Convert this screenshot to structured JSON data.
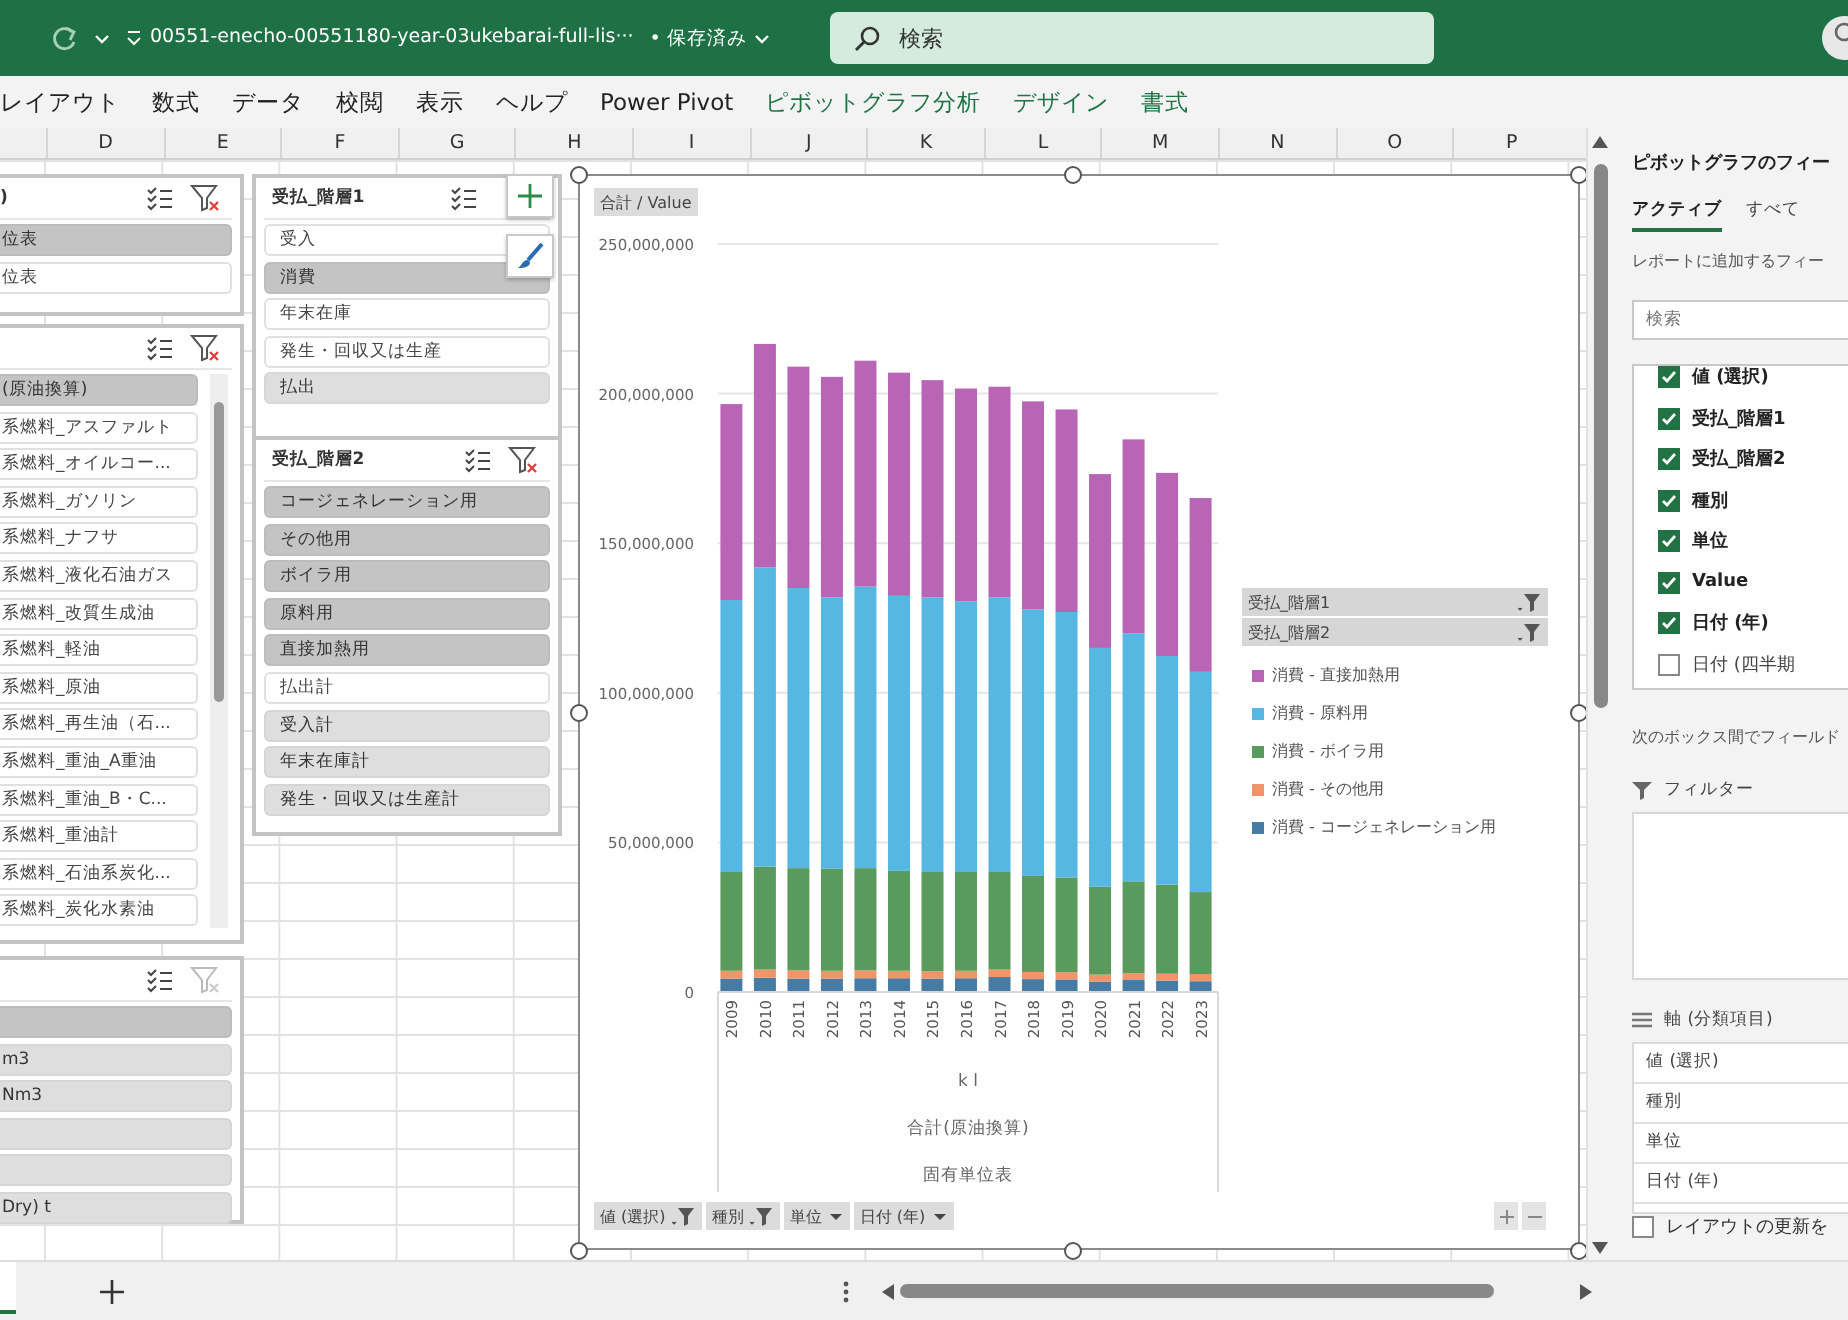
{
  "title_bar": {
    "title": "00551-enecho-00551180-year-03ukebarai-full-lis···",
    "save_status": "• 保存済み",
    "search": {
      "placeholder": "検索"
    }
  },
  "ribbon_tabs": [
    {
      "label": "レイアウト",
      "contextual": false
    },
    {
      "label": "数式",
      "contextual": false
    },
    {
      "label": "データ",
      "contextual": false
    },
    {
      "label": "校閲",
      "contextual": false
    },
    {
      "label": "表示",
      "contextual": false
    },
    {
      "label": "ヘルプ",
      "contextual": false
    },
    {
      "label": "Power Pivot",
      "contextual": false
    },
    {
      "label": "ピボットグラフ分析",
      "contextual": true
    },
    {
      "label": "デザイン",
      "contextual": true
    },
    {
      "label": "書式",
      "contextual": true
    }
  ],
  "columns": [
    "D",
    "E",
    "F",
    "G",
    "H",
    "I",
    "J",
    "K",
    "L",
    "M",
    "N",
    "O",
    "P"
  ],
  "slicers": [
    {
      "title": ")",
      "clear_filter_enabled": true,
      "items": [
        {
          "label": "位表",
          "selected": true,
          "has_data": true
        },
        {
          "label": "位表",
          "selected": false,
          "has_data": true
        }
      ]
    },
    {
      "clear_filter_enabled": true,
      "items": [
        {
          "label": "(原油換算)",
          "selected": true,
          "has_data": true
        },
        {
          "label": "系燃料_アスファルト",
          "selected": false,
          "has_data": true
        },
        {
          "label": "系燃料_オイルコー...",
          "selected": false,
          "has_data": true
        },
        {
          "label": "系燃料_ガソリン",
          "selected": false,
          "has_data": true
        },
        {
          "label": "系燃料_ナフサ",
          "selected": false,
          "has_data": true
        },
        {
          "label": "系燃料_液化石油ガス",
          "selected": false,
          "has_data": true
        },
        {
          "label": "系燃料_改質生成油",
          "selected": false,
          "has_data": true
        },
        {
          "label": "系燃料_軽油",
          "selected": false,
          "has_data": true
        },
        {
          "label": "系燃料_原油",
          "selected": false,
          "has_data": true
        },
        {
          "label": "系燃料_再生油（石...",
          "selected": false,
          "has_data": true
        },
        {
          "label": "系燃料_重油_A重油",
          "selected": false,
          "has_data": true
        },
        {
          "label": "系燃料_重油_B・C...",
          "selected": false,
          "has_data": true
        },
        {
          "label": "系燃料_重油計",
          "selected": false,
          "has_data": true
        },
        {
          "label": "系燃料_石油系炭化...",
          "selected": false,
          "has_data": true
        },
        {
          "label": "系燃料_炭化水素油",
          "selected": false,
          "has_data": true
        }
      ]
    },
    {
      "clear_filter_enabled": false,
      "items": [
        {
          "selected": true,
          "has_data": true
        },
        {
          "label": "m3",
          "selected": true,
          "has_data": false
        },
        {
          "label": "Nm3",
          "selected": true,
          "has_data": false
        },
        {
          "selected": true,
          "has_data": false
        },
        {
          "selected": true,
          "has_data": false
        },
        {
          "label": "Dry) t",
          "selected": true,
          "has_data": false
        }
      ]
    },
    {
      "title": "受払_階層1",
      "items": [
        {
          "label": "受入",
          "selected": false,
          "has_data": true
        },
        {
          "label": "消費",
          "selected": true,
          "has_data": true
        },
        {
          "label": "年末在庫",
          "selected": false,
          "has_data": true
        },
        {
          "label": "発生・回収又は生産",
          "selected": false,
          "has_data": true
        },
        {
          "label": "払出",
          "selected": true,
          "has_data": false
        }
      ]
    },
    {
      "title": "受払_階層2",
      "clear_filter_enabled": true,
      "items": [
        {
          "label": "コージェネレーション用",
          "selected": true,
          "has_data": true
        },
        {
          "label": "その他用",
          "selected": true,
          "has_data": true
        },
        {
          "label": "ボイラ用",
          "selected": true,
          "has_data": true
        },
        {
          "label": "原料用",
          "selected": true,
          "has_data": true
        },
        {
          "label": "直接加熱用",
          "selected": true,
          "has_data": true
        },
        {
          "label": "払出計",
          "selected": false,
          "has_data": true
        },
        {
          "label": "受入計",
          "selected": true,
          "has_data": false
        },
        {
          "label": "年末在庫計",
          "selected": true,
          "has_data": false
        },
        {
          "label": "発生・回収又は生産計",
          "selected": true,
          "has_data": false
        }
      ]
    }
  ],
  "chart": {
    "value_button": "合計 / Value",
    "legend_fields": [
      {
        "label": "受払_階層1",
        "filtered": true
      },
      {
        "label": "受払_階層2",
        "filtered": true
      }
    ],
    "axis_fields": [
      {
        "label": "値 (選択)",
        "filtered": true
      },
      {
        "label": "種別",
        "filtered": true
      },
      {
        "label": "単位",
        "filtered": false
      },
      {
        "label": "日付 (年)",
        "filtered": false
      }
    ],
    "category_levels": [
      "k l",
      "合計(原油換算)",
      "固有単位表"
    ],
    "chart_data": {
      "type": "bar",
      "stacked": true,
      "orientation": "vertical",
      "grid": true,
      "categories": [
        "2009",
        "2010",
        "2011",
        "2012",
        "2013",
        "2014",
        "2015",
        "2016",
        "2017",
        "2018",
        "2019",
        "2020",
        "2021",
        "2022",
        "2023"
      ],
      "ylim": [
        0,
        250000000
      ],
      "yticks": [
        {
          "value": 0,
          "label": "0"
        },
        {
          "value": 50000000,
          "label": "50,000,000"
        },
        {
          "value": 100000000,
          "label": "100,000,000"
        },
        {
          "value": 150000000,
          "label": "150,000,000"
        },
        {
          "value": 200000000,
          "label": "200,000,000"
        },
        {
          "value": 250000000,
          "label": "250,000,000"
        }
      ],
      "series": [
        {
          "name": "消費 - コージェネレーション用",
          "color": "#467ba3",
          "values": [
            4500000,
            4800000,
            4500000,
            4500000,
            4600000,
            4600000,
            4500000,
            4600000,
            5000000,
            4300000,
            4200000,
            3500000,
            4000000,
            3800000,
            3600000
          ]
        },
        {
          "name": "消費 - その他用",
          "color": "#f39468",
          "values": [
            2600000,
            2700000,
            2700000,
            2600000,
            2600000,
            2500000,
            2400000,
            2500000,
            2500000,
            2400000,
            2400000,
            2300000,
            2300000,
            2300000,
            2400000
          ]
        },
        {
          "name": "消費 - ボイラ用",
          "color": "#5a9a5c",
          "values": [
            33000000,
            34400000,
            34200000,
            34100000,
            34200000,
            33400000,
            33200000,
            33000000,
            32600000,
            32100000,
            31700000,
            29400000,
            30700000,
            29800000,
            27400000
          ]
        },
        {
          "name": "消費 - 原料用",
          "color": "#56b7e2",
          "values": [
            90900000,
            100000000,
            93600000,
            90700000,
            94100000,
            91900000,
            91800000,
            90500000,
            91800000,
            89100000,
            88700000,
            79800000,
            82900000,
            76400000,
            73600000
          ]
        },
        {
          "name": "消費 - 直接加熱用",
          "color": "#b865b5",
          "values": [
            65500000,
            74700000,
            74000000,
            73700000,
            75500000,
            74600000,
            72600000,
            71100000,
            70400000,
            69500000,
            67700000,
            58100000,
            64800000,
            61200000,
            58100000
          ]
        }
      ]
    }
  },
  "field_panel": {
    "title": "ピボットグラフのフィー",
    "tabs": [
      {
        "label": "アクティブ",
        "selected": true
      },
      {
        "label": "すべて",
        "selected": false
      }
    ],
    "instruction": "レポートに追加するフィー",
    "search": {
      "placeholder": "検索"
    },
    "fields": [
      {
        "label": "値 (選択)",
        "checked": true
      },
      {
        "label": "受払_階層1",
        "checked": true
      },
      {
        "label": "受払_階層2",
        "checked": true
      },
      {
        "label": "種別",
        "checked": true
      },
      {
        "label": "単位",
        "checked": true
      },
      {
        "label": "Value",
        "checked": true
      },
      {
        "label": "日付 (年)",
        "checked": true
      },
      {
        "label": "日付 (四半期",
        "checked": false
      }
    ],
    "areas_instruction": "次のボックス間でフィールド",
    "areas": [
      {
        "kind": "filter",
        "title": "フィルター"
      },
      {
        "kind": "axis",
        "title": "軸 (分類項目)",
        "items": [
          "値 (選択)",
          "種別",
          "単位",
          "日付 (年)"
        ]
      }
    ],
    "defer_update": {
      "label": "レイアウトの更新を",
      "checked": false
    }
  }
}
